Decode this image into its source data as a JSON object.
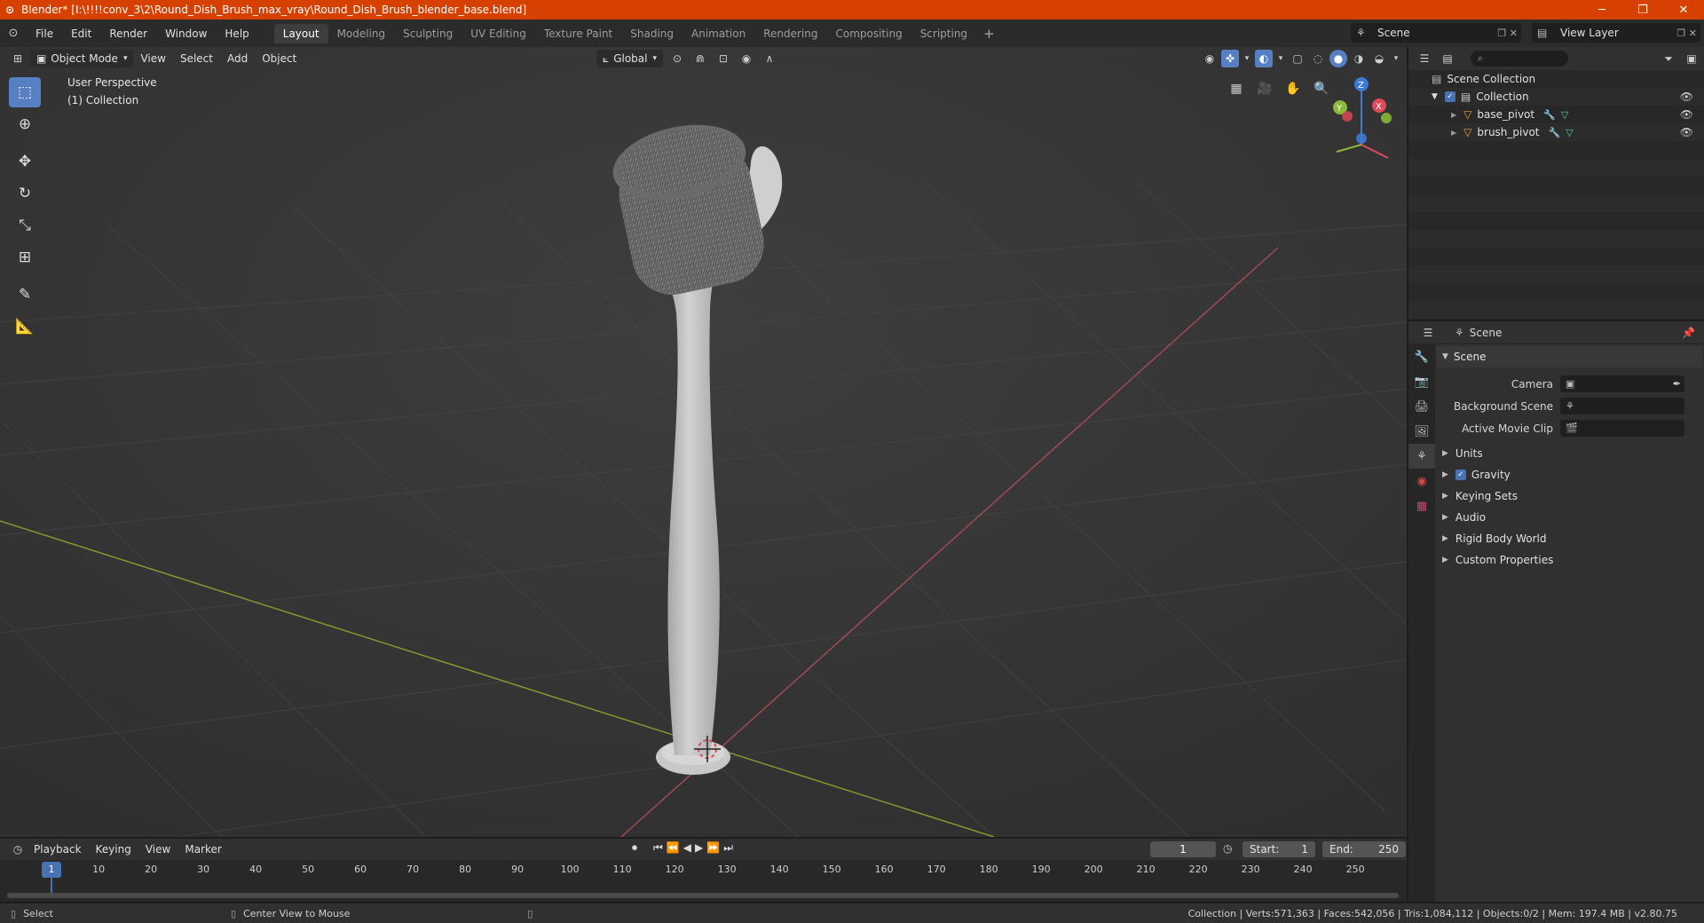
{
  "window": {
    "title": "Blender* [I:\\!!!!conv_3\\2\\Round_Dish_Brush_max_vray\\Round_Dish_Brush_blender_base.blend]",
    "minimize": "─",
    "restore": "❐",
    "close": "✕"
  },
  "menu": {
    "items": [
      "File",
      "Edit",
      "Render",
      "Window",
      "Help"
    ]
  },
  "workspaces": {
    "tabs": [
      "Layout",
      "Modeling",
      "Sculpting",
      "UV Editing",
      "Texture Paint",
      "Shading",
      "Animation",
      "Rendering",
      "Compositing",
      "Scripting"
    ],
    "active": "Layout",
    "add": "+"
  },
  "scene_selector": {
    "value": "Scene"
  },
  "view_layer_selector": {
    "value": "View Layer"
  },
  "viewport": {
    "mode": "Object Mode",
    "menus": [
      "View",
      "Select",
      "Add",
      "Object"
    ],
    "orientation": "Global",
    "perspective_label": "User Perspective",
    "collection_label": "(1) Collection",
    "gizmo_axes": {
      "x": "X",
      "y": "Y",
      "z": "Z"
    },
    "colors": {
      "x_axis": "#e04a57",
      "y_axis": "#8ab83a",
      "z_axis": "#3d7ad6",
      "bg": "#393939",
      "grid": "#444444"
    }
  },
  "outliner": {
    "root": "Scene Collection",
    "collection": "Collection",
    "objects": [
      "base_pivot",
      "brush_pivot"
    ]
  },
  "properties": {
    "header": "Scene",
    "panel": "Scene",
    "fields": [
      {
        "label": "Camera",
        "value": ""
      },
      {
        "label": "Background Scene",
        "value": ""
      },
      {
        "label": "Active Movie Clip",
        "value": ""
      }
    ],
    "subpanels": [
      "Units",
      "Gravity",
      "Keying Sets",
      "Audio",
      "Rigid Body World",
      "Custom Properties"
    ],
    "gravity_checked": true
  },
  "timeline": {
    "menus": [
      "Playback",
      "Keying",
      "View",
      "Marker"
    ],
    "current_frame": "1",
    "start_label": "Start:",
    "start": "1",
    "end_label": "End:",
    "end": "250",
    "ticks": [
      "10",
      "20",
      "30",
      "40",
      "50",
      "60",
      "70",
      "80",
      "90",
      "100",
      "110",
      "120",
      "130",
      "140",
      "150",
      "160",
      "170",
      "180",
      "190",
      "200",
      "210",
      "220",
      "230",
      "240",
      "250"
    ]
  },
  "statusbar": {
    "left_action": "Select",
    "middle_action": "Center View to Mouse",
    "stats": "Collection | Verts:571,363 | Faces:542,056 | Tris:1,084,112 | Objects:0/2 | Mem: 197.4 MB | v2.80.75"
  }
}
